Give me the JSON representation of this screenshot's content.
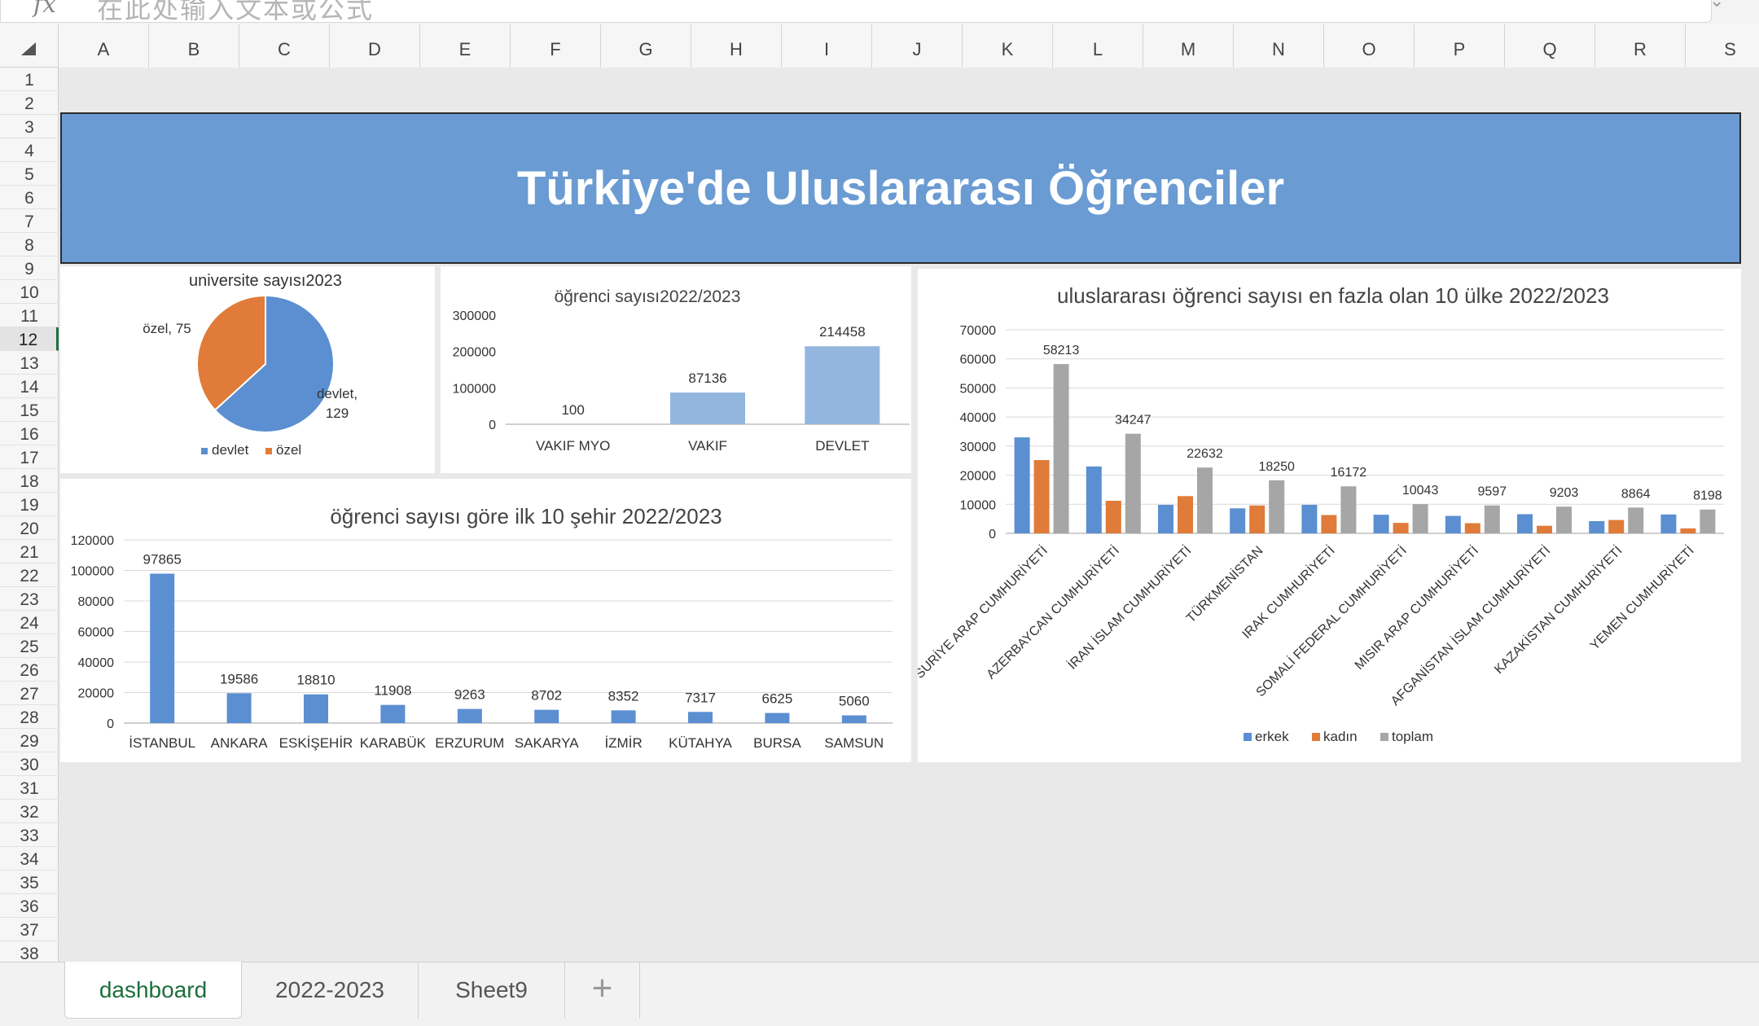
{
  "formula_bar": {
    "fx_label": "fx",
    "placeholder": "在此处输入文本或公式"
  },
  "columns": [
    "A",
    "B",
    "C",
    "D",
    "E",
    "F",
    "G",
    "H",
    "I",
    "J",
    "K",
    "L",
    "M",
    "N",
    "O",
    "P",
    "Q",
    "R",
    "S"
  ],
  "selected_row": 12,
  "banner": {
    "title": "Türkiye'de Uluslararası Öğrenciler"
  },
  "tabs": [
    {
      "label": "dashboard",
      "active": true
    },
    {
      "label": "2022-2023",
      "active": false
    },
    {
      "label": "Sheet9",
      "active": false
    }
  ],
  "colors": {
    "blue": "#5b8fd1",
    "orange": "#e07b39",
    "gray": "#a6a6a6",
    "lightblue": "#93b6de",
    "banner": "#6a9bd2"
  },
  "chart_data": [
    {
      "type": "pie",
      "title": "universite sayısı2023",
      "slices": [
        {
          "label": "devlet",
          "value": 129,
          "data_label": "devlet,\n129"
        },
        {
          "label": "özel",
          "value": 75,
          "data_label": "özel, 75"
        }
      ],
      "legend": [
        "devlet",
        "özel"
      ],
      "legend_position": "bottom"
    },
    {
      "type": "bar",
      "title": "öğrenci sayısı2022/2023",
      "categories": [
        "VAKIF MYO",
        "VAKIF",
        "DEVLET"
      ],
      "values": [
        100,
        87136,
        214458
      ],
      "ylim": [
        0,
        300000
      ],
      "yticks": [
        0,
        100000,
        200000,
        300000
      ],
      "grid": false
    },
    {
      "type": "bar",
      "title": "uluslararası öğrenci sayısı en fazla olan 10 ülke 2022/2023",
      "categories": [
        "SURİYE ARAP CUMHURİYETİ",
        "AZERBAYCAN CUMHURİYETİ",
        "İRAN İSLAM CUMHURİYETİ",
        "TÜRKMENİSTAN",
        "IRAK CUMHURİYETİ",
        "SOMALİ FEDERAL CUMHURİYETİ",
        "MISIR ARAP CUMHURİYETİ",
        "AFGANİSTAN İSLAM CUMHURİYETİ",
        "KAZAKİSTAN CUMHURİYETİ",
        "YEMEN CUMHURİYETİ"
      ],
      "series": [
        {
          "name": "erkek",
          "values": [
            33000,
            23000,
            9800,
            8600,
            9800,
            6400,
            6000,
            6600,
            4200,
            6500
          ]
        },
        {
          "name": "kadın",
          "values": [
            25200,
            11200,
            12800,
            9600,
            6300,
            3600,
            3500,
            2600,
            4600,
            1700
          ]
        },
        {
          "name": "toplam",
          "values": [
            58213,
            34247,
            22632,
            18250,
            16172,
            10043,
            9597,
            9203,
            8864,
            8198
          ]
        }
      ],
      "data_labels": [
        "58213",
        "34247",
        "22632",
        "18250",
        "16172",
        "10043",
        "9597",
        "9203",
        "8864",
        "8198"
      ],
      "ylim": [
        0,
        70000
      ],
      "yticks": [
        0,
        10000,
        20000,
        30000,
        40000,
        50000,
        60000,
        70000
      ],
      "grid": true,
      "legend": [
        "erkek",
        "kadın",
        "toplam"
      ],
      "legend_position": "bottom"
    },
    {
      "type": "bar",
      "title": "öğrenci sayısı göre ilk 10 şehir 2022/2023",
      "categories": [
        "İSTANBUL",
        "ANKARA",
        "ESKİŞEHİR",
        "KARABÜK",
        "ERZURUM",
        "SAKARYA",
        "İZMİR",
        "KÜTAHYA",
        "BURSA",
        "SAMSUN"
      ],
      "values": [
        97865,
        19586,
        18810,
        11908,
        9263,
        8702,
        8352,
        7317,
        6625,
        5060
      ],
      "ylim": [
        0,
        120000
      ],
      "yticks": [
        0,
        20000,
        40000,
        60000,
        80000,
        100000,
        120000
      ],
      "grid": true
    }
  ]
}
